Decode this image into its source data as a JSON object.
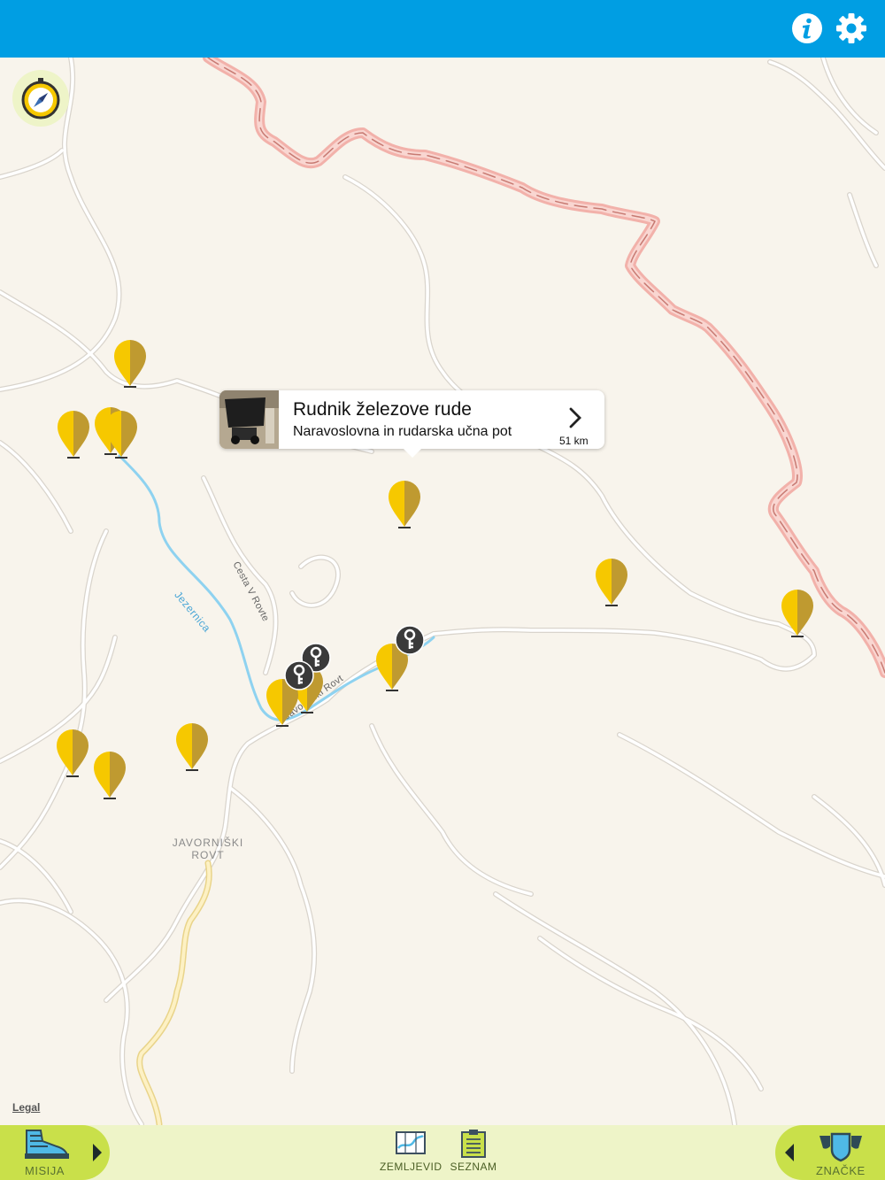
{
  "colors": {
    "top_bar": "#009ee3",
    "map_background": "#f8f4ec",
    "road": "#ffffff",
    "road_outline": "#d9d4cc",
    "border_road": "#f2b1aa",
    "river": "#8ed2f0",
    "yellow_road": "#fbe7a0",
    "pin_yellow": "#f6c800",
    "pin_shade": "#bf9a30",
    "key_marker": "#3a3a3a",
    "bottom_bar": "#eef4c8",
    "tab_green": "#c9e04a"
  },
  "top_bar": {
    "info_icon": "info-icon",
    "settings_icon": "gear-icon"
  },
  "map": {
    "labels": {
      "place": "JAVORNIŠKI\nROVT",
      "river": "Jezernica",
      "street_1": "Cesta V Rovte",
      "street_2": "Javorniški Rovt"
    },
    "legal": "Legal",
    "callout": {
      "title": "Rudnik železove rude",
      "subtitle": "Naravoslovna in rudarska učna pot",
      "distance": "51 km",
      "thumbnail": "mine-cart-photo"
    },
    "pin_count": 15,
    "key_marker_count": 3
  },
  "bottom_bar": {
    "left_tab": "MISIJA",
    "left_icon": "hiking-boot-icon",
    "nav": [
      {
        "label": "ZEMLJEVID",
        "icon": "map-icon"
      },
      {
        "label": "SEZNAM",
        "icon": "clipboard-list-icon"
      }
    ],
    "right_tab": "ZNAČKE",
    "right_icon": "badge-shield-icon"
  }
}
